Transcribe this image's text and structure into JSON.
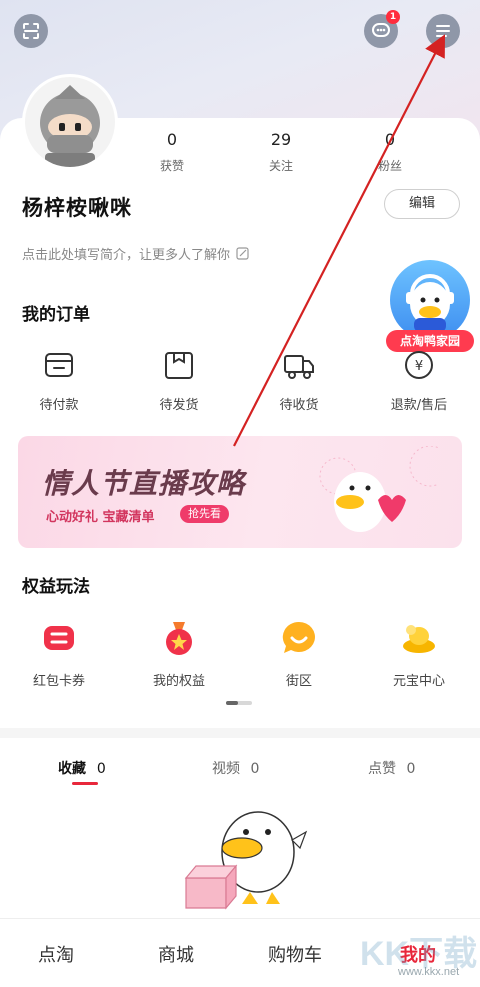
{
  "header": {
    "badge_count": "1"
  },
  "profile": {
    "stats": [
      {
        "value": "0",
        "label": "获赞"
      },
      {
        "value": "29",
        "label": "关注"
      },
      {
        "value": "0",
        "label": "粉丝"
      }
    ],
    "username": "杨梓桉啾咪",
    "edit_label": "编辑",
    "bio_placeholder": "点击此处填写简介，让更多人了解你"
  },
  "orders": {
    "title": "我的订单",
    "items": [
      {
        "label": "待付款",
        "icon": "wallet-icon"
      },
      {
        "label": "待发货",
        "icon": "box-icon"
      },
      {
        "label": "待收货",
        "icon": "truck-icon"
      },
      {
        "label": "退款/售后",
        "icon": "refund-icon"
      }
    ]
  },
  "duck_home": {
    "label": "点淘鸭家园"
  },
  "banner": {
    "title": "情人节直播攻略",
    "subtitle": "心动好礼 宝藏清单",
    "cta": "抢先看"
  },
  "benefits": {
    "title": "权益玩法",
    "items": [
      {
        "label": "红包卡券",
        "icon": "coupon-icon"
      },
      {
        "label": "我的权益",
        "icon": "medal-icon"
      },
      {
        "label": "街区",
        "icon": "chat-bubble-icon"
      },
      {
        "label": "元宝中心",
        "icon": "gold-ingot-icon"
      }
    ]
  },
  "content_tabs": [
    {
      "label": "收藏",
      "count": "0",
      "active": true
    },
    {
      "label": "视频",
      "count": "0",
      "active": false
    },
    {
      "label": "点赞",
      "count": "0",
      "active": false
    }
  ],
  "bottom_nav": [
    {
      "label": "点淘",
      "active": false
    },
    {
      "label": "商城",
      "active": false
    },
    {
      "label": "购物车",
      "active": false
    },
    {
      "label": "我的",
      "active": true
    }
  ],
  "watermark": {
    "brand": "KK下载",
    "url": "www.kkx.net"
  },
  "colors": {
    "accent": "#e8273b",
    "arrow": "#d42222"
  }
}
